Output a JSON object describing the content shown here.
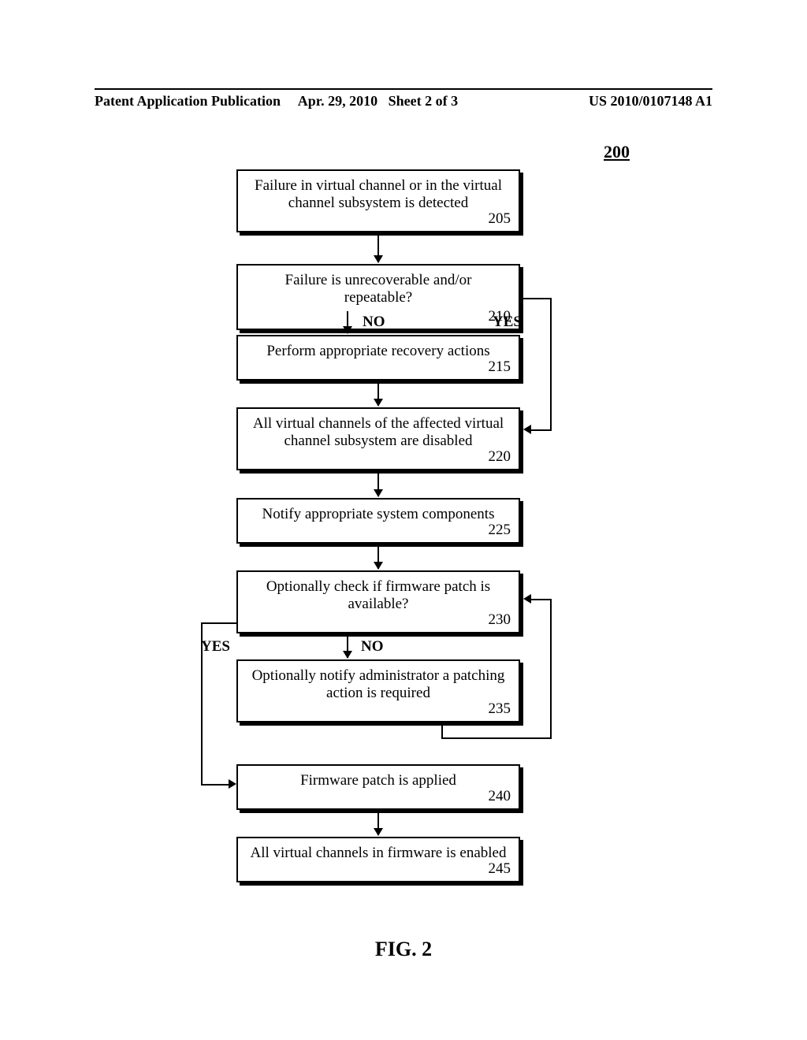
{
  "header": {
    "left": "Patent Application Publication",
    "center": "Apr. 29, 2010   Sheet 2 of 3",
    "right": "US 2010/0107148 A1"
  },
  "figure_ref": "200",
  "caption": "FIG. 2",
  "labels": {
    "yes": "YES",
    "no": "NO"
  },
  "boxes": {
    "b205": {
      "text": "Failure in virtual channel or in the virtual channel subsystem is detected",
      "num": "205"
    },
    "b210": {
      "text": "Failure is unrecoverable and/or repeatable?",
      "num": "210"
    },
    "b215": {
      "text": "Perform appropriate recovery actions",
      "num": "215"
    },
    "b220": {
      "text": "All virtual channels of the affected virtual channel subsystem are disabled",
      "num": "220"
    },
    "b225": {
      "text": "Notify appropriate system components",
      "num": "225"
    },
    "b230": {
      "text": "Optionally check if firmware patch is available?",
      "num": "230"
    },
    "b235": {
      "text": "Optionally notify administrator a patching action is required",
      "num": "235"
    },
    "b240": {
      "text": "Firmware patch is applied",
      "num": "240"
    },
    "b245": {
      "text": "All virtual channels in firmware is enabled",
      "num": "245"
    }
  },
  "chart_data": {
    "type": "flowchart",
    "title": "FIG. 2",
    "ref": "200",
    "nodes": [
      {
        "id": "205",
        "text": "Failure in virtual channel or in the virtual channel subsystem is detected",
        "kind": "process"
      },
      {
        "id": "210",
        "text": "Failure is unrecoverable and/or repeatable?",
        "kind": "decision"
      },
      {
        "id": "215",
        "text": "Perform appropriate recovery actions",
        "kind": "process"
      },
      {
        "id": "220",
        "text": "All virtual channels of the affected virtual channel subsystem are disabled",
        "kind": "process"
      },
      {
        "id": "225",
        "text": "Notify appropriate system components",
        "kind": "process"
      },
      {
        "id": "230",
        "text": "Optionally check if firmware patch is available?",
        "kind": "decision"
      },
      {
        "id": "235",
        "text": "Optionally notify administrator a patching action is required",
        "kind": "process"
      },
      {
        "id": "240",
        "text": "Firmware patch is applied",
        "kind": "process"
      },
      {
        "id": "245",
        "text": "All virtual channels in firmware is enabled",
        "kind": "process"
      }
    ],
    "edges": [
      {
        "from": "205",
        "to": "210"
      },
      {
        "from": "210",
        "to": "215",
        "label": "NO"
      },
      {
        "from": "210",
        "to": "220",
        "label": "YES"
      },
      {
        "from": "215",
        "to": "220"
      },
      {
        "from": "220",
        "to": "225"
      },
      {
        "from": "225",
        "to": "230"
      },
      {
        "from": "230",
        "to": "235",
        "label": "NO"
      },
      {
        "from": "230",
        "to": "240",
        "label": "YES"
      },
      {
        "from": "235",
        "to": "230"
      },
      {
        "from": "240",
        "to": "245"
      }
    ]
  }
}
